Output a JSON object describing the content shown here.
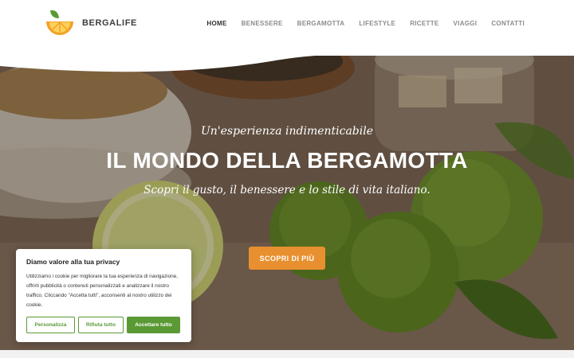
{
  "header": {
    "brand": "BERGALIFE",
    "nav": [
      "HOME",
      "BENESSERE",
      "BERGAMOTTA",
      "LIFESTYLE",
      "RICETTE",
      "VIAGGI",
      "CONTATTI"
    ],
    "active_nav": "HOME"
  },
  "hero": {
    "kicker": "Un'esperienza indimenticabile",
    "title": "IL MONDO DELLA BERGAMOTTA",
    "subtitle": "Scopri il gusto, il benessere e lo stile di vita italiano.",
    "cta_label": "SCOPRI DI PIÙ"
  },
  "cookie": {
    "title": "Diamo valore alla tua privacy",
    "text": "Utilizziamo i cookie per migliorare la tua esperienza di navigazione, offrirti pubblicità o contenuti personalizzati e analizzare il nostro traffico. Cliccando \"Accetta tutti\", acconsenti al nostro utilizzo dei cookie.",
    "customize_label": "Personalizza",
    "reject_label": "Rifiuta tutto",
    "accept_label": "Accettare tutto"
  },
  "colors": {
    "accent_orange": "#e8902f",
    "accent_green": "#5a9a34",
    "nav_active": "#2f2f2f",
    "nav_inactive": "#8b8b8b"
  }
}
